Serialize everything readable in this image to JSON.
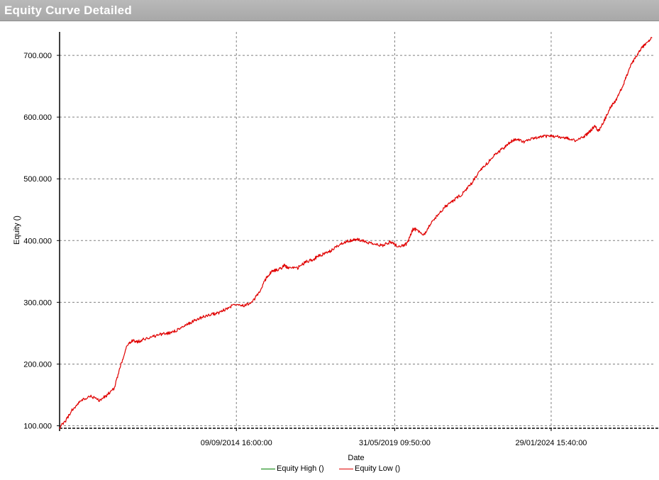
{
  "window": {
    "title": "Equity Curve Detailed"
  },
  "colors": {
    "equity_high": "#008000",
    "equity_low": "#e00000",
    "grid": "#808080",
    "titlebar": "#b0b0b0"
  },
  "chart_data": {
    "type": "line",
    "xlabel": "Date",
    "ylabel": "Equity ()",
    "x_range": [
      "2009-06-01",
      "2027-02-15"
    ],
    "ylim": [
      96,
      738
    ],
    "y_ticks": [
      100,
      200,
      300,
      400,
      500,
      600,
      700
    ],
    "y_tick_labels": [
      "100.000",
      "200.000",
      "300.000",
      "400.000",
      "500.000",
      "600.000",
      "700.000"
    ],
    "x_ticks": [
      "2014-09-09",
      "2019-05-31",
      "2024-01-29"
    ],
    "x_tick_labels": [
      "09/09/2014 16:00:00",
      "31/05/2019 09:50:00",
      "29/01/2024 15:40:00"
    ],
    "grid": true,
    "legend_position": "bottom-center",
    "series": [
      {
        "name": "Equity High ()",
        "x": [],
        "values": []
      },
      {
        "name": "Equity Low ()",
        "x": [
          "2009-06-01",
          "2009-08-01",
          "2009-10-15",
          "2010-01-15",
          "2010-05-01",
          "2010-08-15",
          "2010-11-01",
          "2011-01-15",
          "2011-04-01",
          "2011-06-15",
          "2011-08-15",
          "2011-10-01",
          "2011-12-01",
          "2012-03-01",
          "2012-06-01",
          "2012-09-01",
          "2012-12-01",
          "2013-03-01",
          "2013-06-01",
          "2013-09-01",
          "2013-12-01",
          "2014-03-01",
          "2014-06-01",
          "2014-09-01",
          "2014-12-01",
          "2015-03-01",
          "2015-06-01",
          "2015-08-01",
          "2015-10-01",
          "2015-11-15",
          "2016-01-15",
          "2016-02-15",
          "2016-04-01",
          "2016-07-01",
          "2016-10-01",
          "2017-01-01",
          "2017-03-01",
          "2017-06-01",
          "2017-09-01",
          "2017-12-01",
          "2018-02-15",
          "2018-04-15",
          "2018-07-15",
          "2018-10-15",
          "2019-01-15",
          "2019-04-15",
          "2019-07-15",
          "2019-10-15",
          "2019-12-15",
          "2020-01-15",
          "2020-04-15",
          "2020-06-15",
          "2020-09-01",
          "2020-12-01",
          "2021-03-01",
          "2021-06-01",
          "2021-09-01",
          "2021-12-01",
          "2022-03-01",
          "2022-06-01",
          "2022-09-01",
          "2022-11-15",
          "2023-01-15",
          "2023-04-15",
          "2023-07-15",
          "2023-10-15",
          "2024-01-15",
          "2024-04-15",
          "2024-07-15",
          "2024-10-15",
          "2025-01-15",
          "2025-03-15",
          "2025-05-15",
          "2025-07-01",
          "2025-09-01",
          "2025-11-01",
          "2026-01-15",
          "2026-04-01",
          "2026-06-01",
          "2026-08-01",
          "2026-10-01",
          "2026-12-01",
          "2027-02-01"
        ],
        "values": [
          97,
          107,
          125,
          140,
          148,
          141,
          150,
          160,
          200,
          233,
          238,
          236,
          240,
          244,
          248,
          250,
          255,
          262,
          270,
          276,
          280,
          283,
          290,
          298,
          295,
          300,
          320,
          340,
          350,
          352,
          356,
          360,
          355,
          355,
          365,
          370,
          376,
          380,
          390,
          398,
          400,
          402,
          398,
          394,
          392,
          398,
          390,
          395,
          418,
          418,
          410,
          425,
          440,
          455,
          465,
          475,
          490,
          510,
          525,
          540,
          550,
          560,
          565,
          560,
          565,
          568,
          570,
          568,
          566,
          562,
          568,
          575,
          585,
          578,
          595,
          615,
          630,
          655,
          680,
          695,
          710,
          720,
          728
        ]
      }
    ]
  }
}
